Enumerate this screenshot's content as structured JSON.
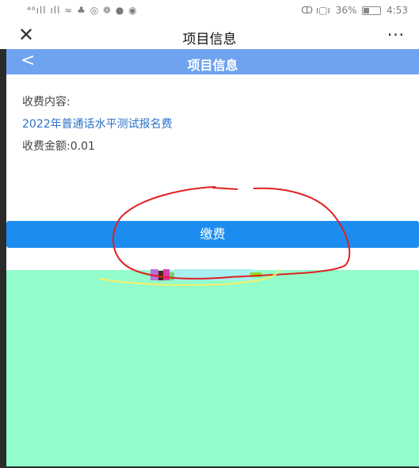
{
  "status_bar": {
    "left": "⁴⁶ıll ıll ≈ ♣ ◎ ❁ ● ◉",
    "right_icons": "ↀ ı▢ı",
    "battery": "36%",
    "battery_level": 0.36,
    "time": "4:53"
  },
  "title_bar": {
    "close_icon": "✕",
    "title": "项目信息",
    "more_icon": "···"
  },
  "header": {
    "back_icon": "<",
    "title": "项目信息"
  },
  "content": {
    "fee_content_label": "收费内容:",
    "fee_name": "2022年普通话水平测试报名费",
    "fee_amount": "收费金额:0.01"
  },
  "pay_button": {
    "label": "缴费"
  },
  "colors": {
    "header_blue": "#6fa3f0",
    "button_blue": "#1d8cf0",
    "link_blue": "#2a72c8",
    "green_area": "#92fdcb",
    "annotation_red": "#e02020",
    "annotation_yellow": "#f4f06a"
  }
}
